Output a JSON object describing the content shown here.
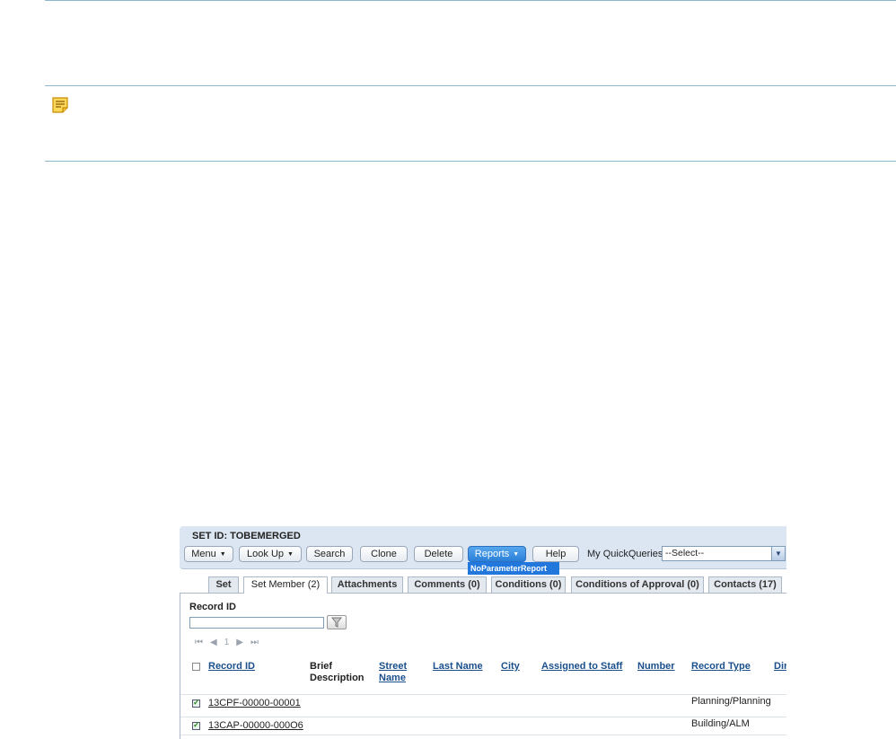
{
  "set": {
    "title": "SET ID: TOBEMERGED"
  },
  "toolbar": {
    "menu_label": "Menu",
    "lookup_label": "Look Up",
    "search_label": "Search",
    "clone_label": "Clone",
    "delete_label": "Delete",
    "reports_label": "Reports",
    "help_label": "Help",
    "quickqueries_label": "My QuickQueries",
    "quickqueries_value": "--Select--"
  },
  "reports_dropdown": {
    "item": "NoParameterReport"
  },
  "tabs": [
    {
      "label": "Set"
    },
    {
      "label": "Set Member (2)"
    },
    {
      "label": "Attachments"
    },
    {
      "label": "Comments (0)"
    },
    {
      "label": "Conditions (0)"
    },
    {
      "label": "Conditions of Approval (0)"
    },
    {
      "label": "Contacts (17)"
    }
  ],
  "filter": {
    "label": "Record ID",
    "value": ""
  },
  "pager": {
    "page": "1"
  },
  "table": {
    "headers": [
      "Record ID",
      "Brief Description",
      "Street Name",
      "Last Name",
      "City",
      "Assigned to Staff",
      "Number",
      "Record Type",
      "Dir"
    ],
    "rows": [
      {
        "record_id": "13CPF-00000-00001",
        "record_type": "Planning/Planning"
      },
      {
        "record_id": "13CAP-00000-000O6",
        "record_type": "Building/ALM"
      }
    ]
  },
  "colors": {
    "accent": "#2277dd",
    "link": "#1a4f8c",
    "toolbar_bg": "#dbe6f2"
  }
}
